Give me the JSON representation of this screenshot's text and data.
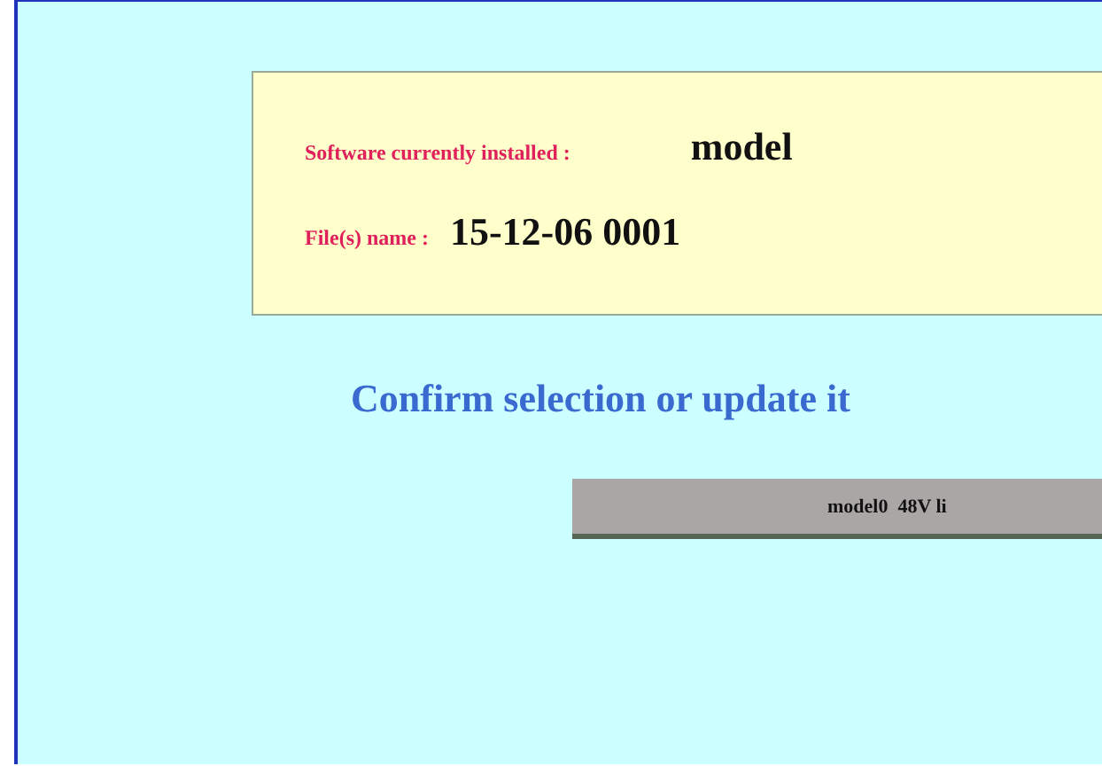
{
  "installed": {
    "label": "Software currently installed :",
    "value": "model"
  },
  "file": {
    "label": "File(s) name :",
    "value": "15-12-06 0001"
  },
  "heading": "Confirm selection or update it",
  "options": [
    {
      "label": "model0  48V li"
    }
  ]
}
